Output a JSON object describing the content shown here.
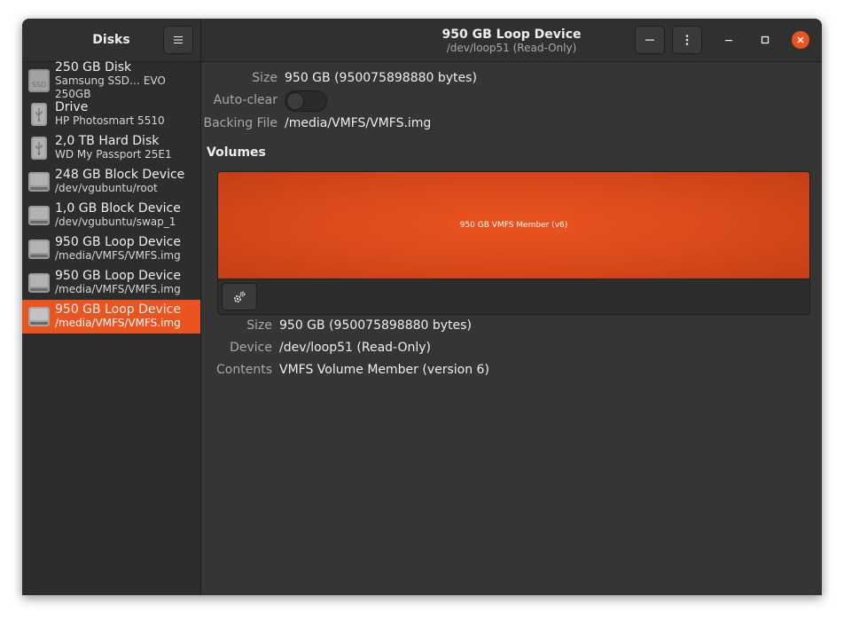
{
  "sidebar_header": {
    "title": "Disks"
  },
  "header": {
    "title": "950 GB Loop Device",
    "subtitle": "/dev/loop51 (Read-Only)"
  },
  "disks": [
    {
      "name": "250 GB Disk",
      "sub": "Samsung SSD… EVO 250GB",
      "icon": "ssd-icon"
    },
    {
      "name": "Drive",
      "sub": "HP Photosmart 5510",
      "icon": "usb-drive-icon"
    },
    {
      "name": "2,0 TB Hard Disk",
      "sub": "WD My Passport 25E1",
      "icon": "usb-drive-icon"
    },
    {
      "name": "248 GB Block Device",
      "sub": "/dev/vgubuntu/root",
      "icon": "hard-disk-icon"
    },
    {
      "name": "1,0 GB Block Device",
      "sub": "/dev/vgubuntu/swap_1",
      "icon": "hard-disk-icon"
    },
    {
      "name": "950 GB Loop Device",
      "sub": "/media/VMFS/VMFS.img",
      "icon": "hard-disk-icon"
    },
    {
      "name": "950 GB Loop Device",
      "sub": "/media/VMFS/VMFS.img",
      "icon": "hard-disk-icon"
    },
    {
      "name": "950 GB Loop Device",
      "sub": "/media/VMFS/VMFS.img",
      "icon": "hard-disk-icon",
      "selected": true
    }
  ],
  "device_info": {
    "size_label": "Size",
    "size_value": "950 GB (950075898880 bytes)",
    "autoclear_label": "Auto-clear",
    "autoclear_on": false,
    "backing_label": "Backing File",
    "backing_value": "/media/VMFS/VMFS.img"
  },
  "volumes": {
    "title": "Volumes",
    "block_label": "950 GB VMFS Member (v6)"
  },
  "volume_info": {
    "size_label": "Size",
    "size_value": "950 GB (950075898880 bytes)",
    "device_label": "Device",
    "device_value": "/dev/loop51 (Read-Only)",
    "contents_label": "Contents",
    "contents_value": "VMFS Volume Member (version 6)"
  },
  "colors": {
    "accent": "#e95420",
    "window_bg": "#353535",
    "sidebar_bg": "#2d2d2d"
  }
}
